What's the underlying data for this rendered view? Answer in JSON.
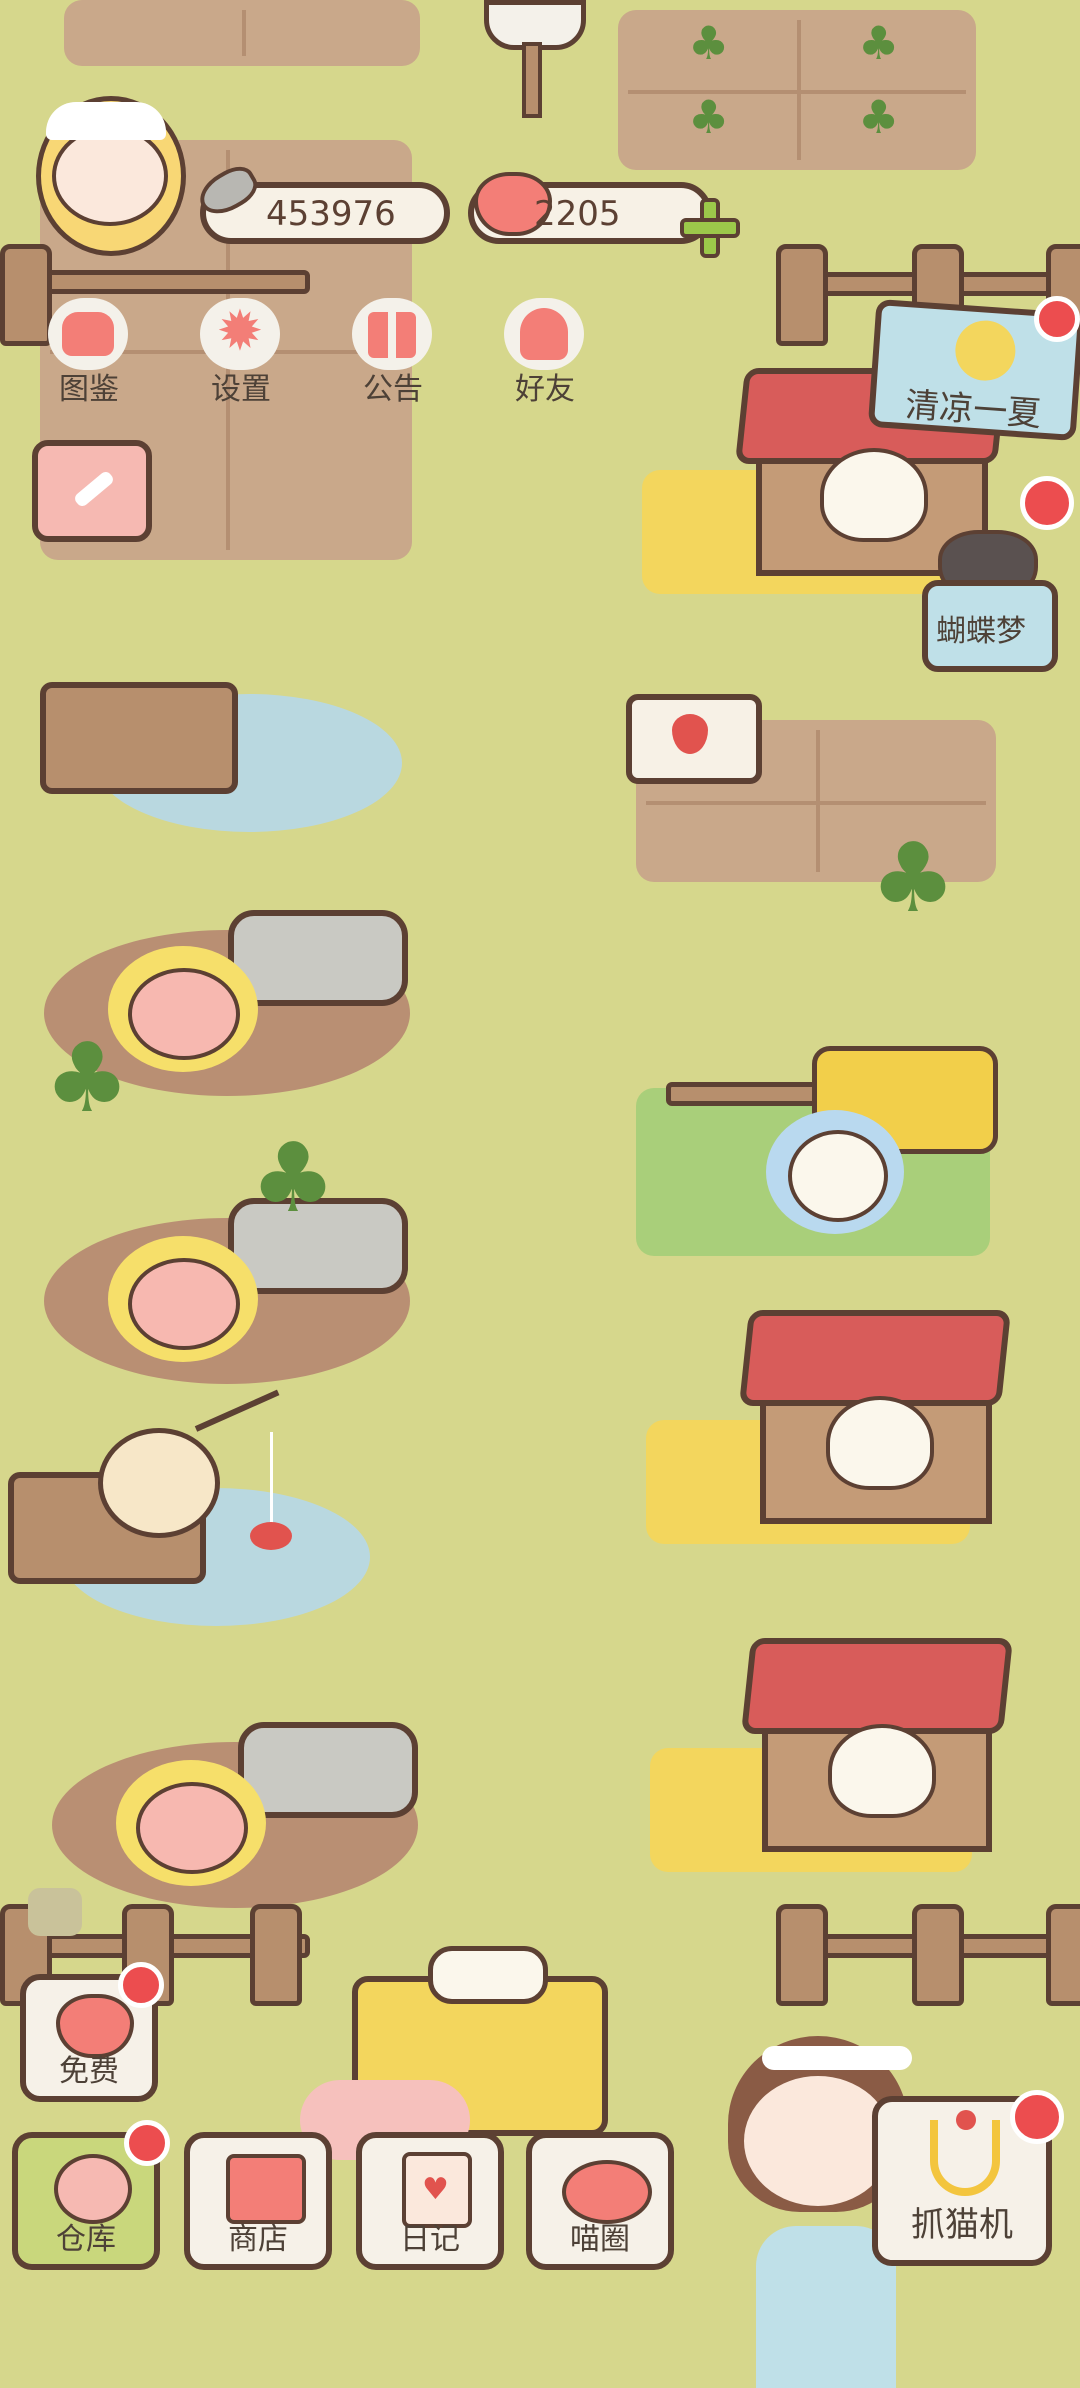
{
  "currency": {
    "fish": "453976",
    "hearts": "2205"
  },
  "top_menu": [
    {
      "label": "图鉴",
      "icon": "cat-book-icon"
    },
    {
      "label": "设置",
      "icon": "gear-icon"
    },
    {
      "label": "公告",
      "icon": "gift-icon"
    },
    {
      "label": "好友",
      "icon": "friends-icon"
    }
  ],
  "events": {
    "summer": "清凉一夏",
    "butterfly": "蝴蝶梦"
  },
  "bottom_bar": {
    "free": "免费",
    "warehouse": "仓库",
    "shop": "商店",
    "diary": "日记",
    "cat_circle": "喵圈",
    "claw_machine": "抓猫机"
  },
  "colors": {
    "grass": "#d6d78c",
    "soil": "#c9a88a",
    "outline": "#5c4033",
    "notification": "#ec4d4f",
    "roof": "#d85c5a"
  }
}
